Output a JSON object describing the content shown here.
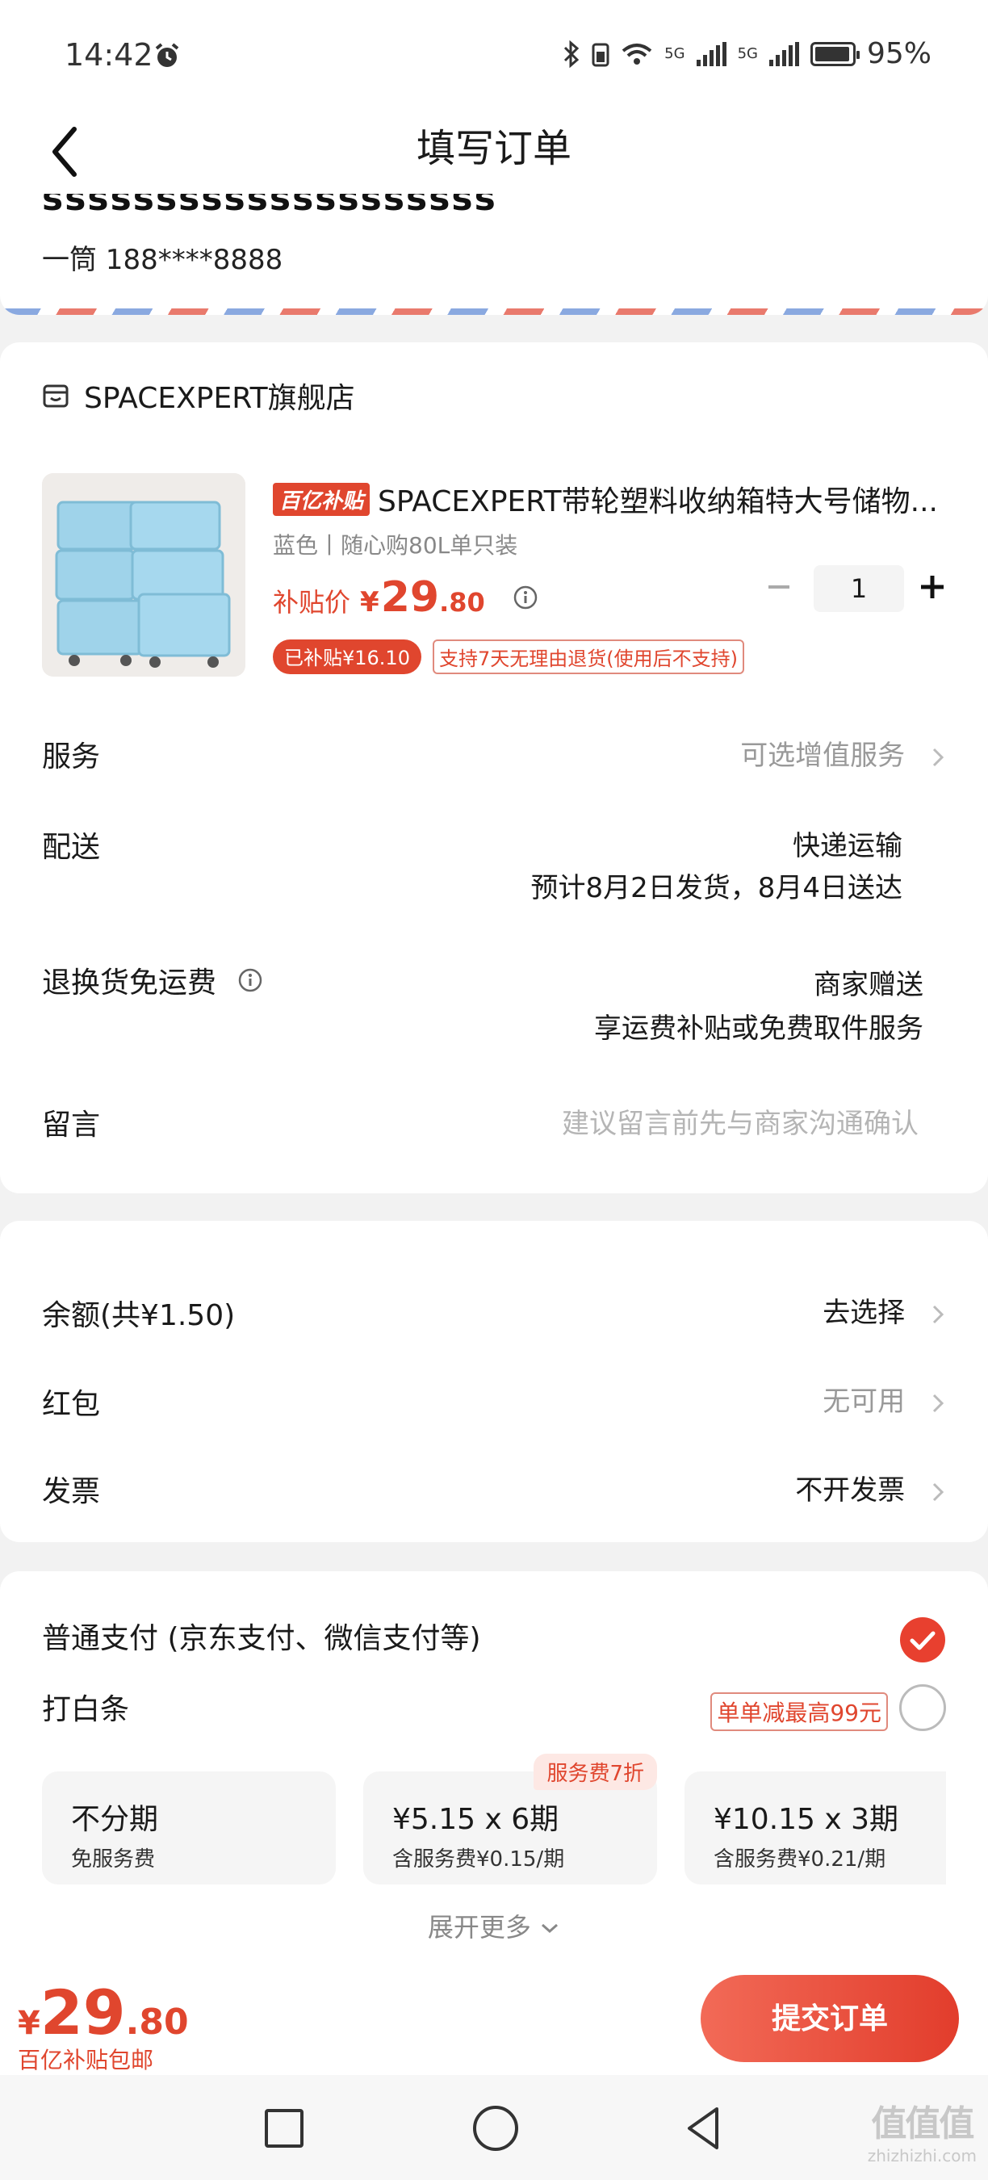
{
  "status_bar": {
    "time": "14:42",
    "battery": "95%",
    "net1": "5G",
    "net2": "5G",
    "battery_level": 0.95
  },
  "header": {
    "title": "填写订单"
  },
  "address": {
    "clipped_line": "ssssssssssssssssssss",
    "person": "一筒  188****8888"
  },
  "shop": {
    "name": "SPACEXPERT旗舰店"
  },
  "product": {
    "tag": "百亿补贴",
    "title": "SPACEXPERT带轮塑料收纳箱特大号储物...",
    "spec": "蓝色丨随心购80L单只装",
    "price_label": "补贴价",
    "currency": "¥",
    "price_int": "29",
    "price_dec": ".80",
    "quantity": "1",
    "subsidy_tag": "已补贴¥16.10",
    "return_tag": "支持7天无理由退货(使用后不支持)"
  },
  "rows": {
    "service_label": "服务",
    "service_value": "可选增值服务",
    "delivery_label": "配送",
    "delivery_value_1": "快递运输",
    "delivery_value_2": "预计8月2日发货，8月4日送达",
    "return_label": "退换货免运费",
    "return_value_1": "商家赠送",
    "return_value_2": "享运费补贴或免费取件服务",
    "note_label": "留言",
    "note_placeholder": "建议留言前先与商家沟通确认"
  },
  "assets": {
    "balance_label": "余额(共¥1.50)",
    "balance_value": "去选择",
    "redpacket_label": "红包",
    "redpacket_value": "无可用",
    "invoice_label": "发票",
    "invoice_value": "不开发票"
  },
  "payment": {
    "normal_label": "普通支付 (京东支付、微信支付等)",
    "baitiao_label": "打白条",
    "baitiao_promo": "单单减最高99元",
    "plans": [
      {
        "main": "不分期",
        "sub": "免服务费",
        "badge": ""
      },
      {
        "main": "¥5.15 x 6期",
        "sub": "含服务费¥0.15/期",
        "badge": "服务费7折"
      },
      {
        "main": "¥10.15 x 3期",
        "sub": "含服务费¥0.21/期",
        "badge": ""
      }
    ],
    "expand_label": "展开更多"
  },
  "footer": {
    "currency": "¥",
    "total_int": "29",
    "total_dec": ".80",
    "note": "百亿补贴包邮",
    "submit_label": "提交订单"
  },
  "watermark": {
    "glyph": "值值值",
    "url": "zhizhizhi.com"
  },
  "colors": {
    "accent": "#e0462e",
    "background": "#f2f2f2"
  }
}
